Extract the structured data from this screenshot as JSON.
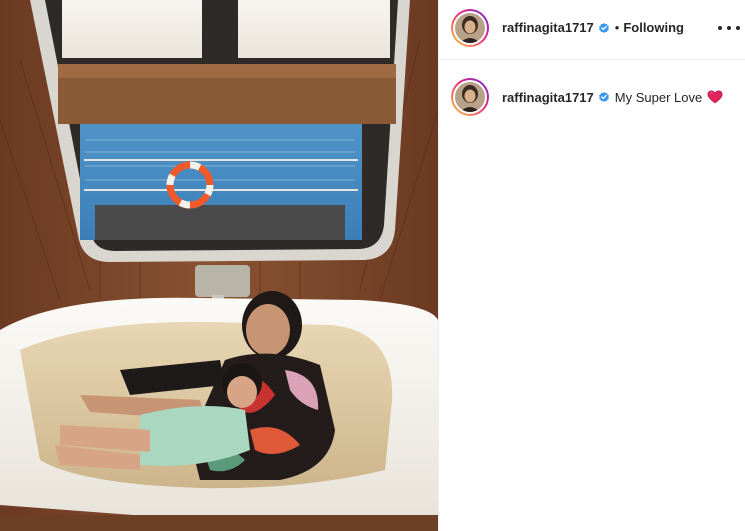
{
  "post": {
    "username": "raffinagita1717",
    "follow_separator": "•",
    "follow_status": "Following",
    "more_icon": "more-options-icon",
    "verified_icon": "verified-badge-icon"
  },
  "caption": {
    "username": "raffinagita1717",
    "text": "My Super Love",
    "emoji_icon": "red-heart-icon"
  },
  "colors": {
    "verified_blue": "#3897f0",
    "heart_red": "#e0245e",
    "border": "#efefef"
  }
}
